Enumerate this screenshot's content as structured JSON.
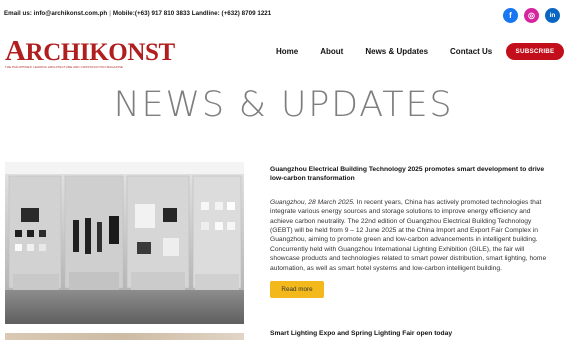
{
  "topbar": {
    "email": "Email us: info@archikonst.com.ph",
    "mobile": "Mobile:(+63) 917 810 3833 Landline: (+632) 8709 1221",
    "separator": "|"
  },
  "social": [
    {
      "icon": "facebook-icon",
      "glyph": "f",
      "color": "#1877f2"
    },
    {
      "icon": "instagram-icon",
      "glyph": "◎",
      "color": "#d6249f"
    },
    {
      "icon": "linkedin-icon",
      "glyph": "in",
      "color": "#0a66c2"
    }
  ],
  "logo": {
    "mark_first": "A",
    "mark_rest": "RCHIKONST",
    "tagline": "THE PHILIPPINES' LEADING ARCHITECTURE AND CONSTRUCTION MAGAZINE",
    "color": "#b01e1e"
  },
  "nav": {
    "items": [
      "Home",
      "About",
      "News & Updates",
      "Contact Us"
    ],
    "subscribe": "SUBSCRIBE",
    "subscribe_color": "#c20f1b"
  },
  "page_title": "NEWS & UPDATES",
  "articles": [
    {
      "title": "Guangzhou Electrical Building Technology 2025 promotes smart development to drive low-carbon transformation",
      "date": "Guangzhou, 28 March 2025.",
      "body": " In recent years, China has actively promoted technologies that integrate various energy sources and storage solutions to improve energy efficiency and achieve carbon neutrality. The 22nd edition of Guangzhou Electrical Building Technology (GEBT) will be held from 9 – 12 June 2025 at the China Import and Export Fair Complex in Guangzhou, aiming to promote green and low-carbon advancements in intelligent building. Concurrently held with Guangzhou International Lighting Exhibition (GILE), the fair will showcase products and technologies related to smart power distribution, smart lighting, home automation, as well as smart hotel systems and low-carbon intelligent building.",
      "read_more": "Read more",
      "read_more_color": "#f2b81c"
    },
    {
      "title": "Smart Lighting Expo and Spring Lighting Fair open today"
    }
  ]
}
